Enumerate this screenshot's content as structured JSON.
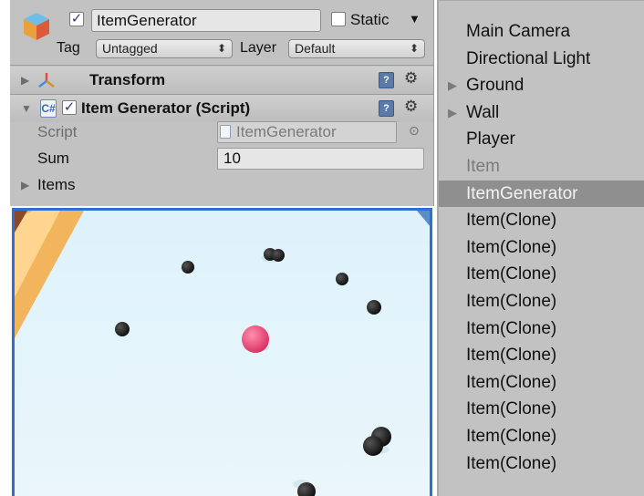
{
  "inspector": {
    "object_name": "ItemGenerator",
    "active": true,
    "static_label": "Static",
    "static_checked": false,
    "tag_label": "Tag",
    "tag_value": "Untagged",
    "layer_label": "Layer",
    "layer_value": "Default",
    "components": {
      "transform": {
        "title": "Transform"
      },
      "script_component": {
        "title": "Item Generator (Script)",
        "enabled": true,
        "fields": {
          "script": {
            "label": "Script",
            "value": "ItemGenerator"
          },
          "sum": {
            "label": "Sum",
            "value": "10"
          },
          "items": {
            "label": "Items"
          }
        }
      }
    }
  },
  "hierarchy": {
    "items": [
      {
        "label": "Main Camera",
        "state": "normal",
        "foldout": false
      },
      {
        "label": "Directional Light",
        "state": "normal",
        "foldout": false
      },
      {
        "label": "Ground",
        "state": "normal",
        "foldout": true
      },
      {
        "label": "Wall",
        "state": "normal",
        "foldout": true
      },
      {
        "label": "Player",
        "state": "normal",
        "foldout": false
      },
      {
        "label": "Item",
        "state": "disabled",
        "foldout": false
      },
      {
        "label": "ItemGenerator",
        "state": "selected",
        "foldout": false
      },
      {
        "label": "Item(Clone)",
        "state": "normal",
        "foldout": false
      },
      {
        "label": "Item(Clone)",
        "state": "normal",
        "foldout": false
      },
      {
        "label": "Item(Clone)",
        "state": "normal",
        "foldout": false
      },
      {
        "label": "Item(Clone)",
        "state": "normal",
        "foldout": false
      },
      {
        "label": "Item(Clone)",
        "state": "normal",
        "foldout": false
      },
      {
        "label": "Item(Clone)",
        "state": "normal",
        "foldout": false
      },
      {
        "label": "Item(Clone)",
        "state": "normal",
        "foldout": false
      },
      {
        "label": "Item(Clone)",
        "state": "normal",
        "foldout": false
      },
      {
        "label": "Item(Clone)",
        "state": "normal",
        "foldout": false
      },
      {
        "label": "Item(Clone)",
        "state": "normal",
        "foldout": false
      }
    ]
  },
  "scene": {
    "colors": {
      "floor": "#e3f4fb",
      "wall": "#f2b45c",
      "player": "#e83f6f",
      "item": "#161616",
      "selection": "#2f6fd0"
    }
  },
  "icons": {
    "gameobject": "gameobject-cube-icon",
    "transform": "transform-axes-icon",
    "script": "csharp-script-icon",
    "help": "book-help-icon",
    "settings": "gear-icon"
  }
}
